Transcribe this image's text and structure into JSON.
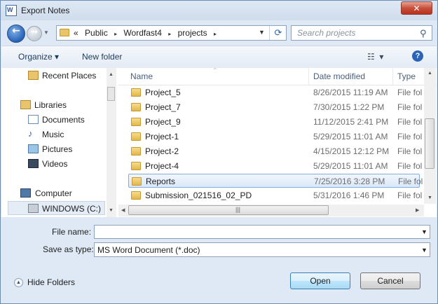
{
  "window": {
    "title": "Export Notes",
    "close_glyph": "✕",
    "app_icon": "wordfast-icon"
  },
  "nav": {
    "breadcrumbs": [
      "«",
      "Public",
      "▸",
      "Wordfast4",
      "▸",
      "projects",
      "▸"
    ],
    "search_placeholder": "Search projects"
  },
  "toolbar": {
    "organize_label": "Organize ▾",
    "new_folder_label": "New folder",
    "help_glyph": "?"
  },
  "sidebar": {
    "items": [
      {
        "label": "Recent Places",
        "icon": "recent-places-icon"
      },
      {
        "label": "Libraries",
        "icon": "libraries-icon"
      },
      {
        "label": "Documents",
        "icon": "documents-icon"
      },
      {
        "label": "Music",
        "icon": "music-icon"
      },
      {
        "label": "Pictures",
        "icon": "pictures-icon"
      },
      {
        "label": "Videos",
        "icon": "videos-icon"
      },
      {
        "label": "Computer",
        "icon": "computer-icon"
      },
      {
        "label": "WINDOWS (C:)",
        "icon": "drive-icon"
      }
    ]
  },
  "file_list": {
    "columns": [
      "Name",
      "Date modified",
      "Type"
    ],
    "rows": [
      {
        "name": "Project_5",
        "date": "8/26/2015 11:19 AM",
        "type": "File fol"
      },
      {
        "name": "Project_7",
        "date": "7/30/2015 1:22 PM",
        "type": "File fol"
      },
      {
        "name": "Project_9",
        "date": "11/12/2015 2:41 PM",
        "type": "File fol"
      },
      {
        "name": "Project-1",
        "date": "5/29/2015 11:01 AM",
        "type": "File fol"
      },
      {
        "name": "Project-2",
        "date": "4/15/2015 12:12 PM",
        "type": "File fol"
      },
      {
        "name": "Project-4",
        "date": "5/29/2015 11:01 AM",
        "type": "File fol"
      },
      {
        "name": "Reports",
        "date": "7/25/2016 3:28 PM",
        "type": "File fol",
        "selected": true
      },
      {
        "name": "Submission_021516_02_PD",
        "date": "5/31/2016 1:46 PM",
        "type": "File fol"
      }
    ]
  },
  "form": {
    "file_name_label": "File name:",
    "file_name_value": "",
    "save_as_label": "Save as type:",
    "save_as_value": "MS Word Document (*.doc)"
  },
  "footer": {
    "hide_folders_label": "Hide Folders",
    "open_label": "Open",
    "cancel_label": "Cancel"
  }
}
